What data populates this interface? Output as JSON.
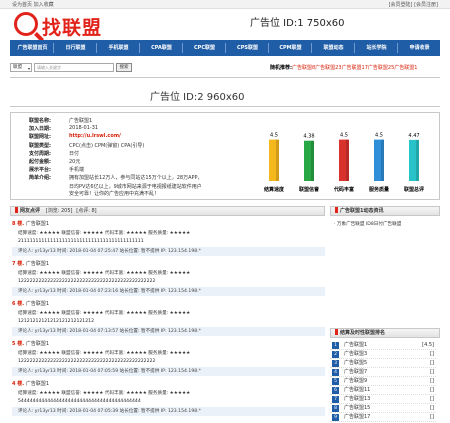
{
  "topbar": {
    "left": "设为首页 加入收藏",
    "right": "[会员登陆] [会员注册]"
  },
  "logo": {
    "text": "找联盟"
  },
  "header": {
    "ad1": "广告位 ID:1 750x60"
  },
  "nav": [
    "广告联盟首页",
    "日行联盟",
    "手机联盟",
    "CPA联盟",
    "CPC联盟",
    "CPS联盟",
    "CPM联盟",
    "联盟动态",
    "站长学院",
    "申请收录"
  ],
  "search": {
    "select": "联盟",
    "placeholder": "请输入关键字",
    "button": "搜索"
  },
  "random": {
    "label": "随机推荐:",
    "items": "广告联盟8广告联盟23广告联盟17广告联盟25广告联盟1"
  },
  "ad2": "广告位 ID:2 960x60",
  "info": {
    "rows": [
      {
        "label": "联盟名称:",
        "value": "广告联盟1"
      },
      {
        "label": "加入日期:",
        "value": "2018-01-31"
      },
      {
        "label": "联盟网址:",
        "value": "http://u.lrswl.com/"
      },
      {
        "label": "联盟类型:",
        "value": "CPC(点击) CPM(弹窗) CPA(引导)"
      },
      {
        "label": "支付周期:",
        "value": "日付"
      },
      {
        "label": "起付金额:",
        "value": "20元"
      },
      {
        "label": "展示平台:",
        "value": "手机端"
      },
      {
        "label": "简单介绍:",
        "value": "拥有加盟站长12万人，参与同站达15万个以上，28万APP，"
      }
    ],
    "intro_extra": [
      "日均PV达6亿以上，9城市网站来源于电视报纸建站软件用户",
      "安全可靠！让你的广告应用中充满不乱！"
    ]
  },
  "chart_data": {
    "type": "bar",
    "categories": [
      "结算速度",
      "联盟信誉",
      "代码丰富",
      "服务质量",
      "联盟总评"
    ],
    "values": [
      4.5,
      4.38,
      4.5,
      4.5,
      4.47
    ],
    "colors": [
      "#f5b81c",
      "#28a745",
      "#d9322c",
      "#2f8fd8",
      "#28c3c8"
    ],
    "ylim": [
      0,
      5
    ]
  },
  "comments_header": {
    "title": "网友点评",
    "views": "[浏览: 205]",
    "comments": "[点评: 8]"
  },
  "comments": [
    {
      "floor": "8 楼.",
      "user": "广告联盟1",
      "ratings": "结算速度: ★★★★★ 联盟信誉: ★★★★★ 代码丰富: ★★★★★ 服务质量: ★★★★★",
      "content": "2111111111111111111111111111111111111111111",
      "meta": "评论人: yr13yr13 时间: 2018-01-04 07:25:47 站长位置: 暂不提供 IP: 123.154.198.*"
    },
    {
      "floor": "7 楼.",
      "user": "广告联盟1",
      "ratings": "结算速度: ★★★★★ 联盟信誉: ★★★★★ 代码丰富: ★★★★★ 服务质量: ★★★★★",
      "content": "12222222222222222222222222222222222222222222222",
      "meta": "评论人: yr13yr13 时间: 2018-01-04 07:23:16 站长位置: 暂不提供 IP: 123.154.198.*"
    },
    {
      "floor": "6 楼.",
      "user": "广告联盟1",
      "ratings": "结算速度: ★★★★★ 联盟信誉: ★★★★★ 代码丰富: ★★★★★ 服务质量: ★★★★★",
      "content": "12121212121212121212121212",
      "meta": "评论人: yr13yr13 时间: 2018-01-04 07:13:57 站长位置: 暂不提供 IP: 123.154.198.*"
    },
    {
      "floor": "5 楼.",
      "user": "广告联盟1",
      "ratings": "结算速度: ★★★★★ 联盟信誉: ★★★★★ 代码丰富: ★★★★★ 服务质量: ★★★★★",
      "content": "12222222222222222222222222222222222222222222222",
      "meta": "评论人: yr13yr13 时间: 2018-01-04 07:05:59 站长位置: 暂不提供 IP: 123.154.198.*"
    },
    {
      "floor": "4 楼.",
      "user": "广告联盟1",
      "ratings": "结算速度: ★★★★★ 联盟信誉: ★★★★★ 代码丰富: ★★★★★ 服务质量: ★★★★★",
      "content": "544444444444444444444444444444444444444444",
      "meta": "评论人: yr13yr13 时间: 2018-01-04 07:05:39 站长位置: 暂不提供 IP: 123.154.198.*"
    }
  ],
  "news": {
    "title": "广告联盟1动态资讯",
    "item": "万象广告联盟 ID8日付广告联盟"
  },
  "ranking": {
    "title": "结算及时性联盟排名",
    "items": [
      {
        "n": "1",
        "name": "广告联盟1",
        "score": "[4.5]"
      },
      {
        "n": "2",
        "name": "广告联盟3",
        "score": "[]"
      },
      {
        "n": "3",
        "name": "广告联盟5",
        "score": "[]"
      },
      {
        "n": "4",
        "name": "广告联盟7",
        "score": "[]"
      },
      {
        "n": "5",
        "name": "广告联盟9",
        "score": "[]"
      },
      {
        "n": "6",
        "name": "广告联盟11",
        "score": "[]"
      },
      {
        "n": "7",
        "name": "广告联盟13",
        "score": "[]"
      },
      {
        "n": "8",
        "name": "广告联盟15",
        "score": "[]"
      },
      {
        "n": "9",
        "name": "广告联盟17",
        "score": "[]"
      }
    ]
  }
}
